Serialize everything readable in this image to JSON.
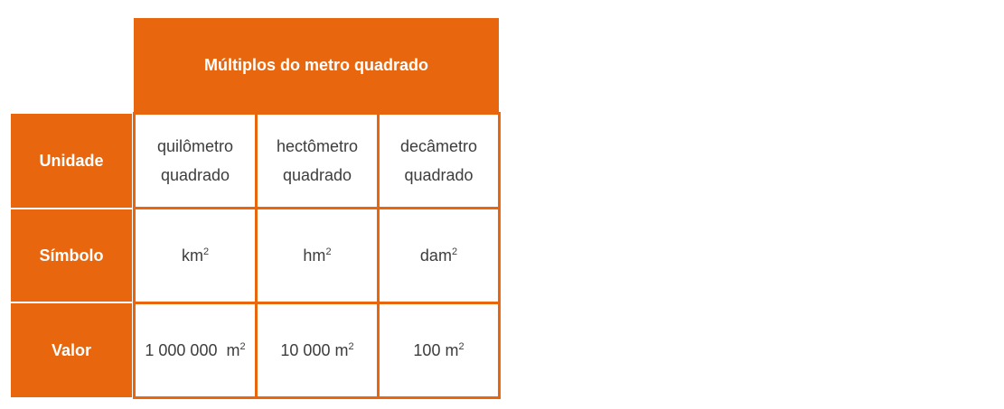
{
  "header": {
    "title": "Múltiplos do metro quadrado"
  },
  "rows": [
    {
      "label": "Unidade",
      "cells": [
        {
          "line1": "quilômetro",
          "line2": "quadrado"
        },
        {
          "line1": "hectômetro",
          "line2": "quadrado"
        },
        {
          "line1": "decâmetro",
          "line2": "quadrado"
        }
      ]
    },
    {
      "label": "Símbolo",
      "cells": [
        {
          "base": "km",
          "exp": "2"
        },
        {
          "base": "hm",
          "exp": "2"
        },
        {
          "base": "dam",
          "exp": "2"
        }
      ]
    },
    {
      "label": "Valor",
      "cells": [
        {
          "base": "1 000 000  m",
          "exp": "2"
        },
        {
          "base": "10 000 m",
          "exp": "2"
        },
        {
          "base": "100 m",
          "exp": "2"
        }
      ]
    }
  ],
  "colors": {
    "accent": "#e8670e",
    "text": "#3d3d3d",
    "header_text": "#ffffff"
  }
}
